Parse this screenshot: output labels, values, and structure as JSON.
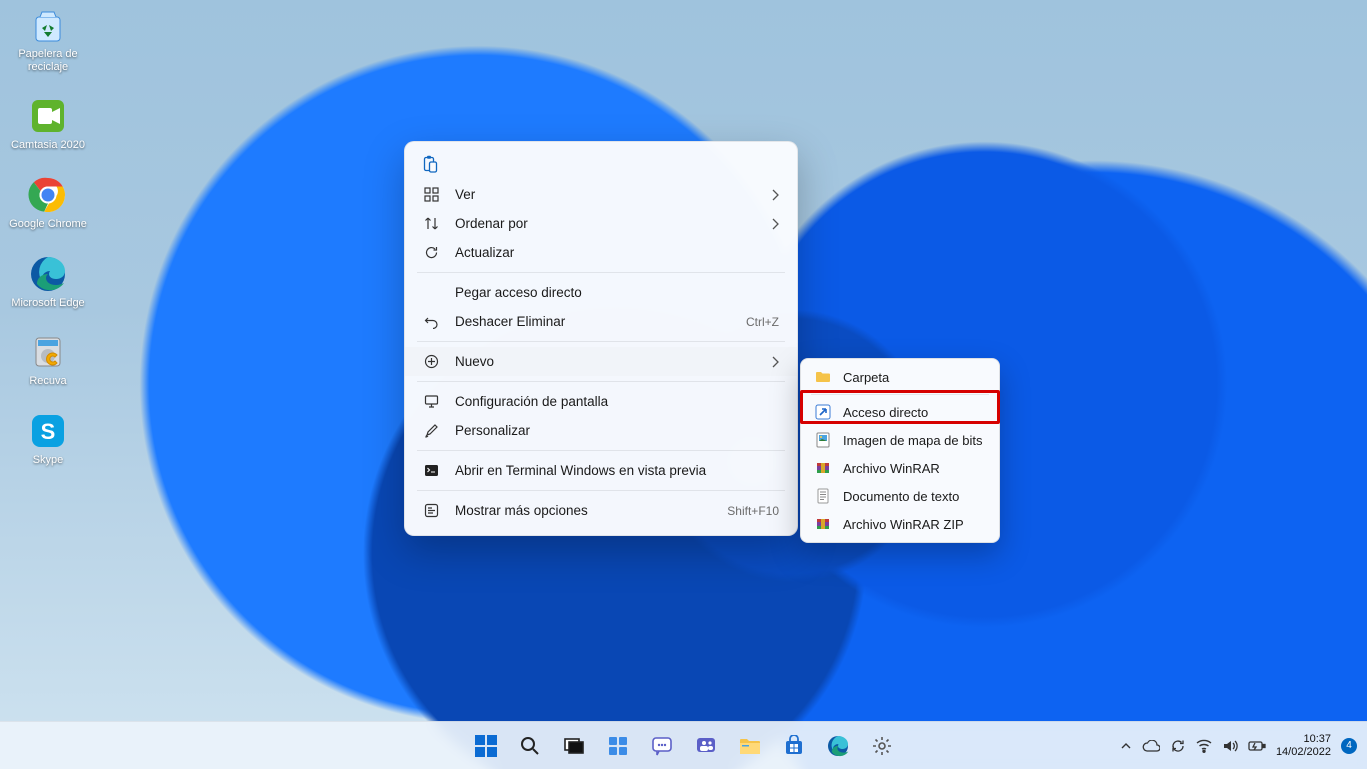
{
  "desktop": {
    "icons": [
      {
        "label": "Papelera de reciclaje",
        "icon": "recycle-bin"
      },
      {
        "label": "Camtasia 2020",
        "icon": "camtasia"
      },
      {
        "label": "Google Chrome",
        "icon": "chrome"
      },
      {
        "label": "Microsoft Edge",
        "icon": "edge"
      },
      {
        "label": "Recuva",
        "icon": "recuva"
      },
      {
        "label": "Skype",
        "icon": "skype"
      }
    ]
  },
  "context_menu": {
    "items": [
      {
        "label": "Ver",
        "icon": "view-grid",
        "submenu": true
      },
      {
        "label": "Ordenar por",
        "icon": "sort",
        "submenu": true
      },
      {
        "label": "Actualizar",
        "icon": "refresh"
      },
      {
        "sep": true
      },
      {
        "label": "Pegar acceso directo"
      },
      {
        "label": "Deshacer Eliminar",
        "icon": "undo",
        "shortcut": "Ctrl+Z"
      },
      {
        "sep": true
      },
      {
        "label": "Nuevo",
        "icon": "new-plus",
        "submenu": true,
        "selected": true,
        "highlighted": true
      },
      {
        "sep": true
      },
      {
        "label": "Configuración de pantalla",
        "icon": "display"
      },
      {
        "label": "Personalizar",
        "icon": "brush"
      },
      {
        "sep": true
      },
      {
        "label": "Abrir en Terminal Windows en vista previa",
        "icon": "terminal"
      },
      {
        "sep": true
      },
      {
        "label": "Mostrar más opciones",
        "icon": "more",
        "shortcut": "Shift+F10"
      }
    ],
    "submenu_new": [
      {
        "label": "Carpeta",
        "icon": "folder"
      },
      {
        "label": "Acceso directo",
        "icon": "shortcut",
        "highlighted": true
      },
      {
        "label": "Imagen de mapa de bits",
        "icon": "bitmap"
      },
      {
        "label": "Archivo WinRAR",
        "icon": "winrar"
      },
      {
        "label": "Documento de texto",
        "icon": "text-doc"
      },
      {
        "label": "Archivo WinRAR ZIP",
        "icon": "winrar-zip"
      }
    ]
  },
  "taskbar": {
    "buttons": [
      "start",
      "search",
      "task-view",
      "widgets",
      "chat",
      "teams",
      "file-explorer",
      "microsoft-store",
      "edge",
      "settings"
    ]
  },
  "systray": {
    "icons": [
      "chevron-up",
      "onedrive",
      "windows-update",
      "wifi",
      "volume",
      "battery"
    ],
    "time": "10:37",
    "date": "14/02/2022",
    "notifications": "4"
  }
}
